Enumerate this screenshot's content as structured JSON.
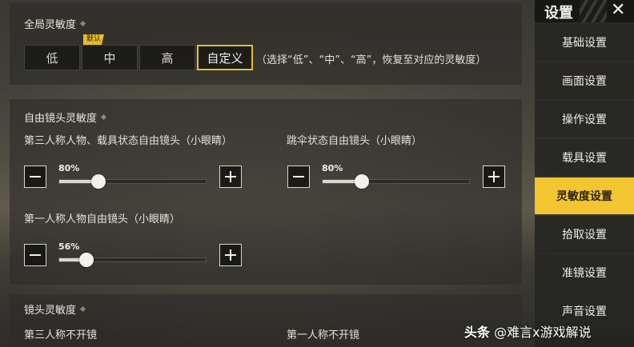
{
  "global_sensitivity": {
    "title": "全局灵敏度",
    "default_tag": "默认",
    "presets": [
      "低",
      "中",
      "高",
      "自定义"
    ],
    "active_preset": "自定义",
    "hint": "（选择“低”、“中”、“高”，恢复至对应的灵敏度）"
  },
  "free_camera": {
    "title": "自由镜头灵敏度",
    "sliders": [
      {
        "label": "第三人称人物、载具状态自由镜头（小眼睛）",
        "value": "80%",
        "fraction": 0.8
      },
      {
        "label": "跳伞状态自由镜头（小眼睛）",
        "value": "80%",
        "fraction": 0.8
      },
      {
        "label": "第一人称人物自由镜头（小眼睛）",
        "value": "56%",
        "fraction": 0.56
      }
    ]
  },
  "lens_sensitivity": {
    "title": "镜头灵敏度",
    "left_label": "第三人称不开镜",
    "right_label": "第一人称不开镜"
  },
  "sidebar": {
    "title": "设置",
    "close": "✕",
    "items": [
      "基础设置",
      "画面设置",
      "操作设置",
      "载具设置",
      "灵敏度设置",
      "拾取设置",
      "准镜设置",
      "声音设置"
    ],
    "active": "灵敏度设置"
  },
  "watermark": {
    "brand": "头条",
    "handle": "@难言x游戏解说"
  },
  "colors": {
    "accent": "#e6bd2a",
    "active_sidebar": "#f2c531"
  }
}
